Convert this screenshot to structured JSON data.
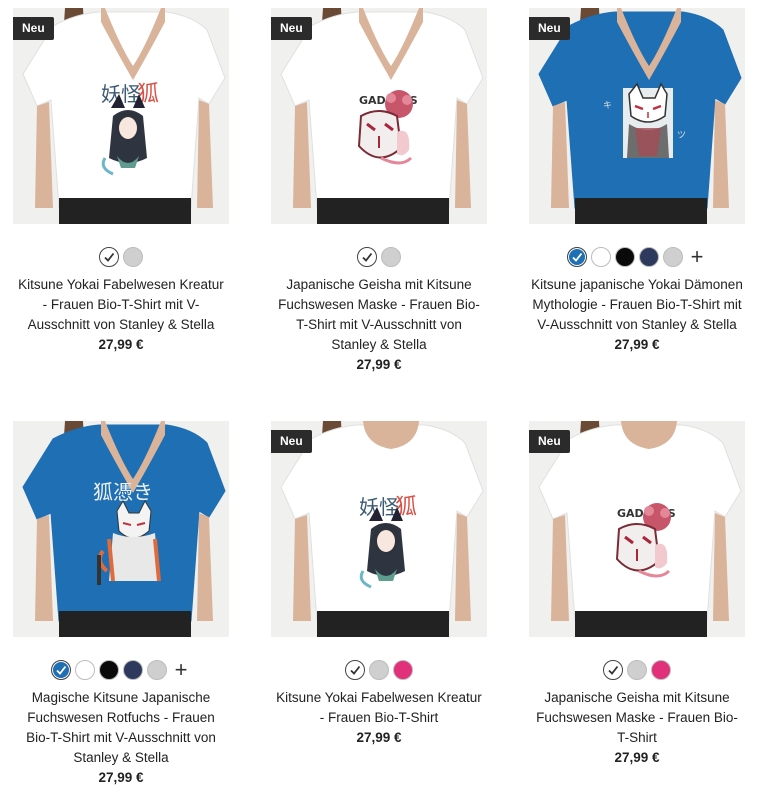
{
  "products": [
    {
      "badge": "Neu",
      "title": "Kitsune Yokai Fabelwesen Kreatur - Frauen Bio-T-Shirt mit V-Ausschnitt von Stanley & Stella",
      "price": "27,99 €",
      "shirt_color": "#ffffff",
      "design": "kitsune-girl",
      "swatches": [
        "#ffffff",
        "#cfcfcf"
      ],
      "selected": 0,
      "more": false
    },
    {
      "badge": "Neu",
      "title": "Japanische Geisha mit Kitsune Fuchswesen Maske - Frauen Bio-T-Shirt mit V-Ausschnitt von Stanley & Stella",
      "price": "27,99 €",
      "shirt_color": "#ffffff",
      "design": "geisha",
      "swatches": [
        "#ffffff",
        "#cfcfcf"
      ],
      "selected": 0,
      "more": false
    },
    {
      "badge": "Neu",
      "title": "Kitsune japanische Yokai Dämonen Mythologie - Frauen Bio-T-Shirt mit V-Ausschnitt von Stanley & Stella",
      "price": "27,99 €",
      "shirt_color": "#1e6fb3",
      "design": "mask",
      "swatches": [
        "#1e6fb3",
        "#ffffff",
        "#0a0a0a",
        "#2d3a5e",
        "#cfcfcf"
      ],
      "selected": 0,
      "more": true
    },
    {
      "badge": "",
      "title": "Magische Kitsune Japanische Fuchswesen Rotfuchs - Frauen Bio-T-Shirt mit V-Ausschnitt von Stanley & Stella",
      "price": "27,99 €",
      "shirt_color": "#1e6fb3",
      "design": "rotfuchs",
      "swatches": [
        "#1e6fb3",
        "#ffffff",
        "#0a0a0a",
        "#2d3a5e",
        "#cfcfcf"
      ],
      "selected": 0,
      "more": true
    },
    {
      "badge": "Neu",
      "title": "Kitsune Yokai Fabelwesen Kreatur - Frauen Bio-T-Shirt",
      "price": "27,99 €",
      "shirt_color": "#ffffff",
      "design": "kitsune-girl",
      "swatches": [
        "#ffffff",
        "#cfcfcf",
        "#e0317a"
      ],
      "selected": 0,
      "more": false
    },
    {
      "badge": "Neu",
      "title": "Japanische Geisha mit Kitsune Fuchswesen Maske - Frauen Bio-T-Shirt",
      "price": "27,99 €",
      "shirt_color": "#ffffff",
      "design": "geisha",
      "swatches": [
        "#ffffff",
        "#cfcfcf",
        "#e0317a"
      ],
      "selected": 0,
      "more": false
    }
  ],
  "design_text": {
    "geisha_caption": "GADDESS",
    "kitsune_glyphs": "妖怪狐",
    "rotfuchs_glyphs": "狐憑き"
  }
}
